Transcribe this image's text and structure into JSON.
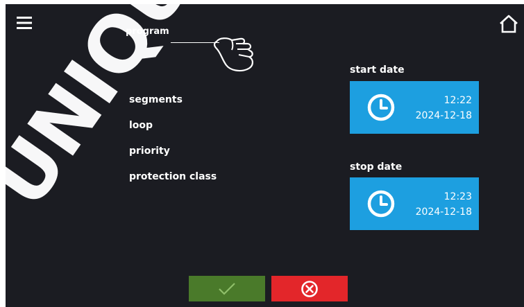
{
  "watermark": "UNIQUE",
  "header": {
    "menu_icon": "hamburger-menu-icon",
    "home_icon": "home-icon"
  },
  "form": {
    "program_label": "program",
    "segments_label": "segments",
    "loop_label": "loop",
    "priority_label": "priority",
    "protection_class_label": "protection class"
  },
  "start": {
    "label": "start date",
    "time": "12:22",
    "date": "2024-12-18",
    "icon": "clock-icon"
  },
  "stop": {
    "label": "stop date",
    "time": "12:23",
    "date": "2024-12-18",
    "icon": "clock-icon"
  },
  "actions": {
    "confirm_icon": "checkmark-icon",
    "cancel_icon": "cancel-circle-icon"
  },
  "colors": {
    "background": "#1b1c22",
    "tile": "#1d9fe0",
    "confirm": "#4a7a2a",
    "cancel": "#e3262a"
  }
}
